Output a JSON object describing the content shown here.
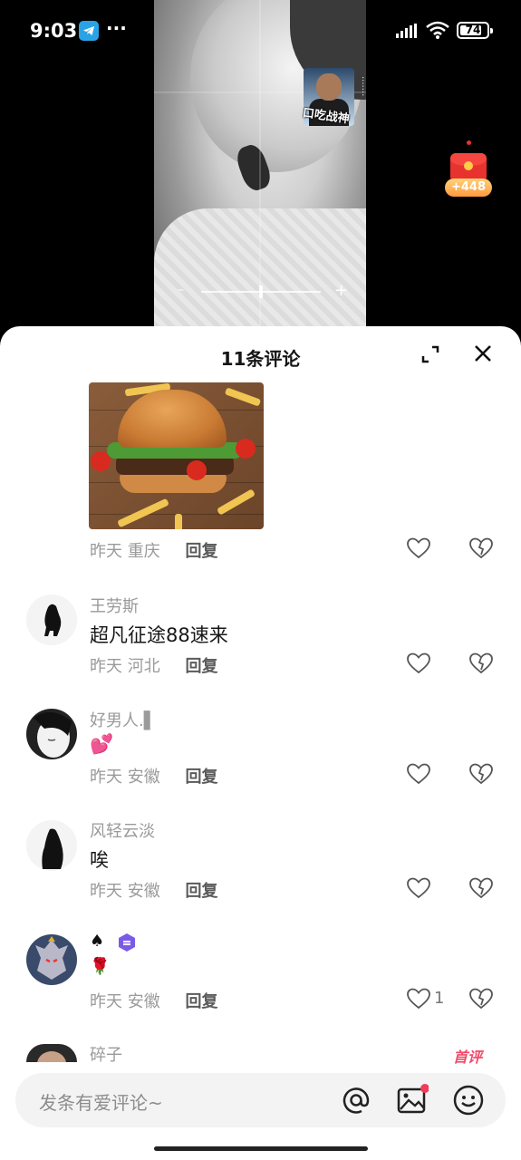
{
  "status_bar": {
    "time": "9:03",
    "more": "···",
    "battery": "74"
  },
  "video": {
    "pip_label": "口吃战神",
    "side_text": "·······"
  },
  "red_packet": {
    "amount": "+448"
  },
  "comments_panel": {
    "title": "11条评论",
    "reply_label": "回复",
    "comments": [
      {
        "time": "昨天",
        "location": "重庆"
      },
      {
        "user": "王劳斯",
        "text": "超凡征途88速来",
        "time": "昨天",
        "location": "河北"
      },
      {
        "user": "好男人.▌",
        "text": "💕",
        "time": "昨天",
        "location": "安徽"
      },
      {
        "user": "风轻云淡",
        "text": "唉",
        "time": "昨天",
        "location": "安徽"
      },
      {
        "user": "♠",
        "text": "🌹",
        "time": "昨天",
        "location": "安徽",
        "likes": "1"
      },
      {
        "user": "碎子",
        "badge": "首评"
      }
    ]
  },
  "input": {
    "placeholder": "发条有爱评论~"
  }
}
